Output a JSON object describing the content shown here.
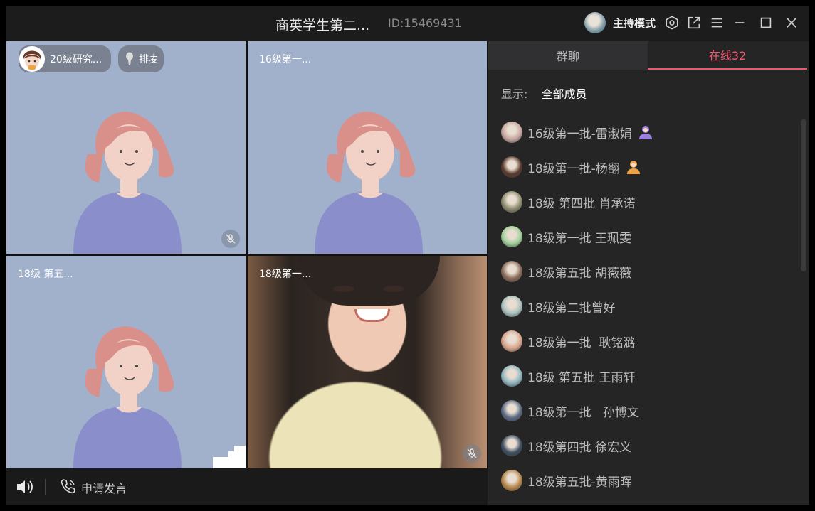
{
  "titlebar": {
    "title": "商英学生第二...",
    "room_id": "ID:15469431",
    "host_mode": "主持模式",
    "icons": [
      "settings-icon",
      "external-window-icon",
      "menu-icon",
      "minimize-icon",
      "maximize-icon",
      "close-icon"
    ]
  },
  "video": {
    "top_left_user": "20级研究...",
    "queue_label": "排麦",
    "tiles": [
      {
        "name": ""
      },
      {
        "name": "16级第一..."
      },
      {
        "name": "18级 第五..."
      },
      {
        "name": "18级第一..."
      }
    ]
  },
  "bottom": {
    "speak_request": "申请发言"
  },
  "panel": {
    "tab_chat": "群聊",
    "tab_online": "在线32",
    "filter_label": "显示:",
    "filter_value": "全部成员",
    "members": [
      {
        "name": "16级第一批-雷淑娟",
        "badge": "purple",
        "avatar": "#c7a5a0"
      },
      {
        "name": "18级第一批-杨翻",
        "badge": "orange",
        "avatar": "#5a3a2e"
      },
      {
        "name": "18级 第四批 肖承诺",
        "badge": "",
        "avatar": "#8e8c70"
      },
      {
        "name": "18级第一批 王珮雯",
        "badge": "",
        "avatar": "#9fcf9a"
      },
      {
        "name": "18级第五批 胡薇薇",
        "badge": "",
        "avatar": "#8a6a5a"
      },
      {
        "name": "18级第二批曾好",
        "badge": "",
        "avatar": "#a9c2c0"
      },
      {
        "name": "18级第一批  耿铭潞",
        "badge": "",
        "avatar": "#d9a58c"
      },
      {
        "name": "18级 第五批 王雨轩",
        "badge": "",
        "avatar": "#8fb6c0"
      },
      {
        "name": "18级第一批   孙博文",
        "badge": "",
        "avatar": "#5b6b85"
      },
      {
        "name": "18级第四批 徐宏义",
        "badge": "",
        "avatar": "#3e4e62"
      },
      {
        "name": "18级第五批-黄雨晖",
        "badge": "",
        "avatar": "#b8864c"
      }
    ]
  },
  "colors": {
    "accent": "#f0566e",
    "tile_bg": "#a1b1cc",
    "panel_bg": "#252525"
  }
}
